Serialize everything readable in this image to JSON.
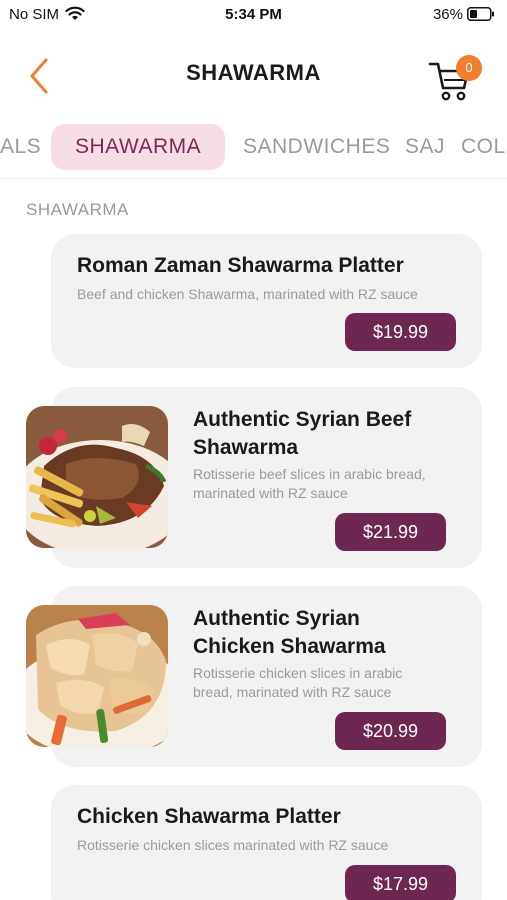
{
  "status_bar": {
    "carrier": "No SIM",
    "time": "5:34 PM",
    "battery": "36%"
  },
  "header": {
    "title": "SHAWARMA",
    "cart_count": "0",
    "accent_color": "#f08030"
  },
  "tabs": [
    {
      "label": "ALS",
      "active": false
    },
    {
      "label": "SHAWARMA",
      "active": true
    },
    {
      "label": "SANDWICHES",
      "active": false
    },
    {
      "label": "SAJ",
      "active": false
    },
    {
      "label": "COL",
      "active": false
    }
  ],
  "section": {
    "label": "SHAWARMA"
  },
  "items": [
    {
      "name": "Roman Zaman Shawarma Platter",
      "description": "Beef and chicken Shawarma, marinated with RZ sauce",
      "price": "$19.99"
    },
    {
      "name_line1": "Authentic Syrian Beef",
      "name_line2": "Shawarma",
      "description_line1": "Rotisserie beef slices in arabic bread,",
      "description_line2": "marinated with RZ sauce",
      "price": "$21.99",
      "image": "beef-shawarma-plate"
    },
    {
      "name_line1": "Authentic Syrian",
      "name_line2": "Chicken Shawarma",
      "description_line1": "Rotisserie chicken slices in arabic",
      "description_line2": "bread, marinated with RZ sauce",
      "price": "$20.99",
      "image": "chicken-shawarma-plate"
    },
    {
      "name": "Chicken Shawarma Platter",
      "description": "Rotisserie chicken slices marinated with RZ sauce",
      "price": "$17.99"
    }
  ],
  "colors": {
    "price_button": "#6e2750",
    "active_tab_bg": "#f7dde6",
    "active_tab_text": "#7a2a53"
  }
}
